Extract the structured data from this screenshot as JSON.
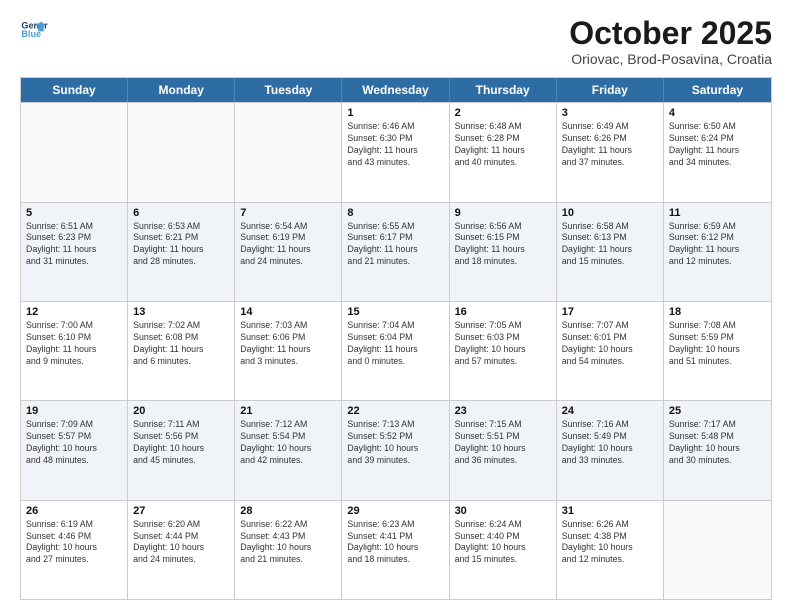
{
  "header": {
    "logo_line1": "General",
    "logo_line2": "Blue",
    "month_title": "October 2025",
    "subtitle": "Oriovac, Brod-Posavina, Croatia"
  },
  "weekdays": [
    "Sunday",
    "Monday",
    "Tuesday",
    "Wednesday",
    "Thursday",
    "Friday",
    "Saturday"
  ],
  "rows": [
    [
      {
        "day": "",
        "info": ""
      },
      {
        "day": "",
        "info": ""
      },
      {
        "day": "",
        "info": ""
      },
      {
        "day": "1",
        "info": "Sunrise: 6:46 AM\nSunset: 6:30 PM\nDaylight: 11 hours\nand 43 minutes."
      },
      {
        "day": "2",
        "info": "Sunrise: 6:48 AM\nSunset: 6:28 PM\nDaylight: 11 hours\nand 40 minutes."
      },
      {
        "day": "3",
        "info": "Sunrise: 6:49 AM\nSunset: 6:26 PM\nDaylight: 11 hours\nand 37 minutes."
      },
      {
        "day": "4",
        "info": "Sunrise: 6:50 AM\nSunset: 6:24 PM\nDaylight: 11 hours\nand 34 minutes."
      }
    ],
    [
      {
        "day": "5",
        "info": "Sunrise: 6:51 AM\nSunset: 6:23 PM\nDaylight: 11 hours\nand 31 minutes."
      },
      {
        "day": "6",
        "info": "Sunrise: 6:53 AM\nSunset: 6:21 PM\nDaylight: 11 hours\nand 28 minutes."
      },
      {
        "day": "7",
        "info": "Sunrise: 6:54 AM\nSunset: 6:19 PM\nDaylight: 11 hours\nand 24 minutes."
      },
      {
        "day": "8",
        "info": "Sunrise: 6:55 AM\nSunset: 6:17 PM\nDaylight: 11 hours\nand 21 minutes."
      },
      {
        "day": "9",
        "info": "Sunrise: 6:56 AM\nSunset: 6:15 PM\nDaylight: 11 hours\nand 18 minutes."
      },
      {
        "day": "10",
        "info": "Sunrise: 6:58 AM\nSunset: 6:13 PM\nDaylight: 11 hours\nand 15 minutes."
      },
      {
        "day": "11",
        "info": "Sunrise: 6:59 AM\nSunset: 6:12 PM\nDaylight: 11 hours\nand 12 minutes."
      }
    ],
    [
      {
        "day": "12",
        "info": "Sunrise: 7:00 AM\nSunset: 6:10 PM\nDaylight: 11 hours\nand 9 minutes."
      },
      {
        "day": "13",
        "info": "Sunrise: 7:02 AM\nSunset: 6:08 PM\nDaylight: 11 hours\nand 6 minutes."
      },
      {
        "day": "14",
        "info": "Sunrise: 7:03 AM\nSunset: 6:06 PM\nDaylight: 11 hours\nand 3 minutes."
      },
      {
        "day": "15",
        "info": "Sunrise: 7:04 AM\nSunset: 6:04 PM\nDaylight: 11 hours\nand 0 minutes."
      },
      {
        "day": "16",
        "info": "Sunrise: 7:05 AM\nSunset: 6:03 PM\nDaylight: 10 hours\nand 57 minutes."
      },
      {
        "day": "17",
        "info": "Sunrise: 7:07 AM\nSunset: 6:01 PM\nDaylight: 10 hours\nand 54 minutes."
      },
      {
        "day": "18",
        "info": "Sunrise: 7:08 AM\nSunset: 5:59 PM\nDaylight: 10 hours\nand 51 minutes."
      }
    ],
    [
      {
        "day": "19",
        "info": "Sunrise: 7:09 AM\nSunset: 5:57 PM\nDaylight: 10 hours\nand 48 minutes."
      },
      {
        "day": "20",
        "info": "Sunrise: 7:11 AM\nSunset: 5:56 PM\nDaylight: 10 hours\nand 45 minutes."
      },
      {
        "day": "21",
        "info": "Sunrise: 7:12 AM\nSunset: 5:54 PM\nDaylight: 10 hours\nand 42 minutes."
      },
      {
        "day": "22",
        "info": "Sunrise: 7:13 AM\nSunset: 5:52 PM\nDaylight: 10 hours\nand 39 minutes."
      },
      {
        "day": "23",
        "info": "Sunrise: 7:15 AM\nSunset: 5:51 PM\nDaylight: 10 hours\nand 36 minutes."
      },
      {
        "day": "24",
        "info": "Sunrise: 7:16 AM\nSunset: 5:49 PM\nDaylight: 10 hours\nand 33 minutes."
      },
      {
        "day": "25",
        "info": "Sunrise: 7:17 AM\nSunset: 5:48 PM\nDaylight: 10 hours\nand 30 minutes."
      }
    ],
    [
      {
        "day": "26",
        "info": "Sunrise: 6:19 AM\nSunset: 4:46 PM\nDaylight: 10 hours\nand 27 minutes."
      },
      {
        "day": "27",
        "info": "Sunrise: 6:20 AM\nSunset: 4:44 PM\nDaylight: 10 hours\nand 24 minutes."
      },
      {
        "day": "28",
        "info": "Sunrise: 6:22 AM\nSunset: 4:43 PM\nDaylight: 10 hours\nand 21 minutes."
      },
      {
        "day": "29",
        "info": "Sunrise: 6:23 AM\nSunset: 4:41 PM\nDaylight: 10 hours\nand 18 minutes."
      },
      {
        "day": "30",
        "info": "Sunrise: 6:24 AM\nSunset: 4:40 PM\nDaylight: 10 hours\nand 15 minutes."
      },
      {
        "day": "31",
        "info": "Sunrise: 6:26 AM\nSunset: 4:38 PM\nDaylight: 10 hours\nand 12 minutes."
      },
      {
        "day": "",
        "info": ""
      }
    ]
  ]
}
